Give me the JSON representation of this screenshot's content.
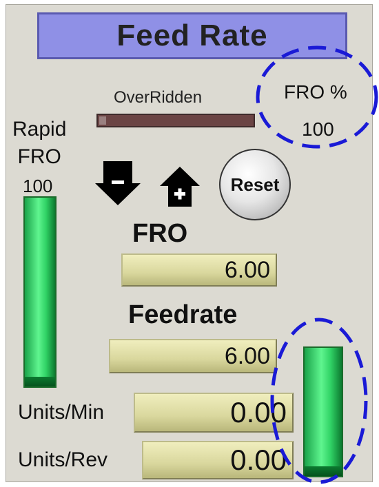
{
  "title": "Feed Rate",
  "overridden": {
    "label": "OverRidden",
    "active": false
  },
  "fro_percent": {
    "label": "FRO %",
    "value": "100"
  },
  "rapid_fro": {
    "label_line1": "Rapid",
    "label_line2": "FRO",
    "value": "100",
    "level": 1.0
  },
  "buttons": {
    "decrease_icon": "arrow-down-minus-icon",
    "increase_icon": "arrow-up-plus-icon",
    "reset_label": "Reset"
  },
  "fro": {
    "label": "FRO",
    "value": "6.00"
  },
  "feedrate": {
    "label": "Feedrate",
    "value": "6.00",
    "level": 1.0
  },
  "units_min": {
    "label": "Units/Min",
    "value": "0.00"
  },
  "units_rev": {
    "label": "Units/Rev",
    "value": "0.00"
  },
  "colors": {
    "title_bg": "#8f90e6",
    "panel_bg": "#dcdad2",
    "dro_bg": "#d9d79d",
    "bar_green": "#30d265",
    "annotation_blue": "#1a1ad6"
  }
}
